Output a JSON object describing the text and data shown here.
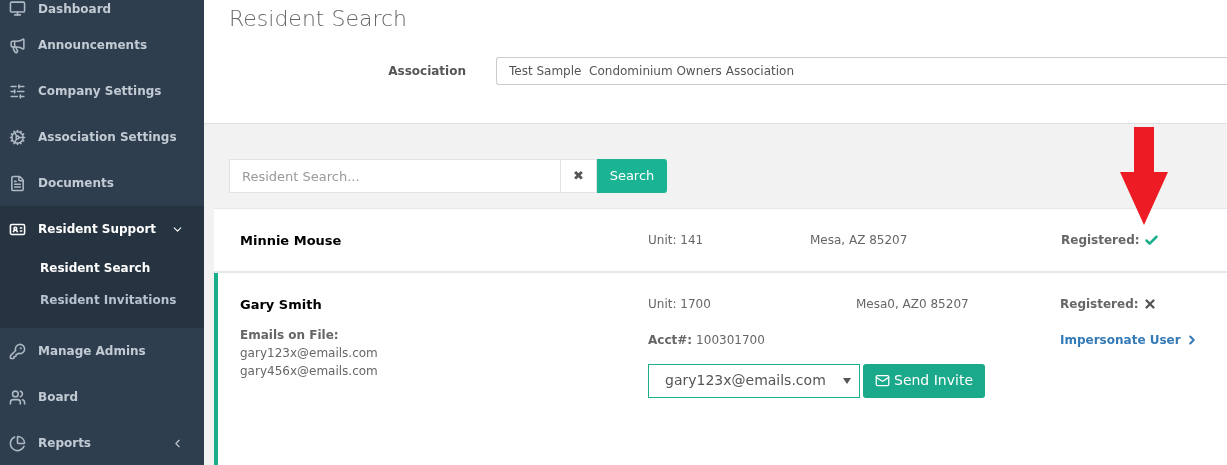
{
  "sidebar": {
    "items": [
      {
        "label": "Dashboard"
      },
      {
        "label": "Announcements"
      },
      {
        "label": "Company Settings"
      },
      {
        "label": "Association Settings"
      },
      {
        "label": "Documents"
      },
      {
        "label": "Resident Support",
        "expanded": true,
        "children": [
          {
            "label": "Resident Search",
            "selected": true
          },
          {
            "label": "Resident Invitations",
            "selected": false
          }
        ]
      },
      {
        "label": "Manage Admins"
      },
      {
        "label": "Board"
      },
      {
        "label": "Reports",
        "expanded": false
      }
    ]
  },
  "page_title": "Resident Search",
  "association": {
    "label": "Association",
    "value": "Test Sample  Condominium Owners Association"
  },
  "search": {
    "placeholder": "Resident Search...",
    "clear": "✖",
    "button": "Search"
  },
  "residents": [
    {
      "name": "Minnie Mouse",
      "unit": "Unit: 141",
      "city": "Mesa, AZ 85207",
      "registered_label": "Registered:",
      "registered": true,
      "expanded": false
    },
    {
      "name": "Gary Smith",
      "unit": "Unit: 1700",
      "city": "Mesa0, AZ0 85207",
      "registered_label": "Registered:",
      "registered": false,
      "expanded": true,
      "emails_label": "Emails on File:",
      "emails": [
        "gary123x@emails.com",
        "gary456x@emails.com"
      ],
      "acct_label": "Acct#:",
      "acct": "100301700",
      "invite_email": "gary123x@emails.com",
      "send_button": "Send Invite",
      "impersonate": "Impersonate User"
    }
  ]
}
